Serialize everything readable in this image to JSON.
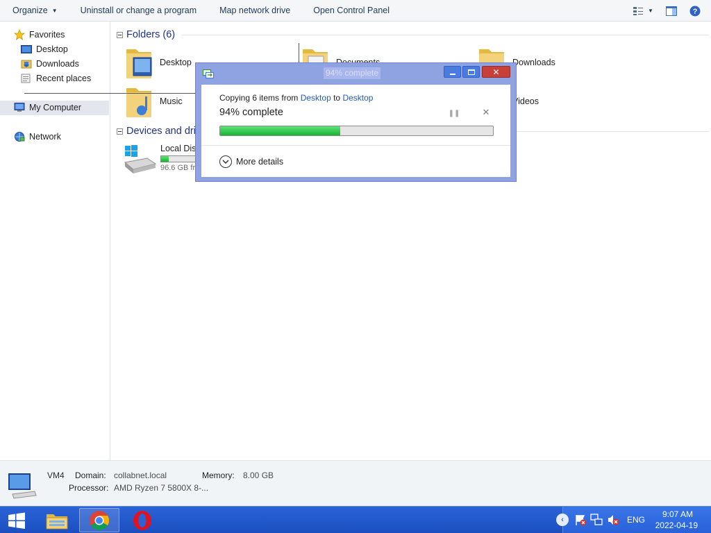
{
  "toolbar": {
    "organize": "Organize",
    "uninstall": "Uninstall or change a program",
    "map_drive": "Map network drive",
    "control_panel": "Open Control Panel"
  },
  "sidebar": {
    "favorites": "Favorites",
    "desktop": "Desktop",
    "downloads": "Downloads",
    "recent": "Recent places",
    "my_computer": "My Computer",
    "network": "Network"
  },
  "main": {
    "folders_header": "Folders (6)",
    "folders": {
      "desktop": "Desktop",
      "documents": "Documents",
      "downloads": "Downloads",
      "music": "Music",
      "videos": "Videos"
    },
    "devices_header": "Devices and dri",
    "local_disk": {
      "name": "Local Disk",
      "free_text": "96.6 GB fr",
      "used_fraction": 0.22
    }
  },
  "details": {
    "name": "VM4",
    "domain_label": "Domain:",
    "domain_value": "collabnet.local",
    "memory_label": "Memory:",
    "memory_value": "8.00 GB",
    "processor_label": "Processor:",
    "processor_value": "AMD Ryzen 7 5800X 8-..."
  },
  "dialog": {
    "title": "94% complete",
    "copy_prefix": "Copying 6 items from ",
    "source": "Desktop",
    "to_word": " to ",
    "destination": "Desktop",
    "percent_text": "94% complete",
    "progress_fraction": 0.44,
    "more_details": "More details"
  },
  "taskbar": {
    "lang": "ENG",
    "time": "9:07 AM",
    "date": "2022-04-19"
  },
  "colors": {
    "taskbar": "#2a63d6",
    "progress": "#17b533",
    "link": "#1e5bb5",
    "group_header": "#1e3287"
  }
}
